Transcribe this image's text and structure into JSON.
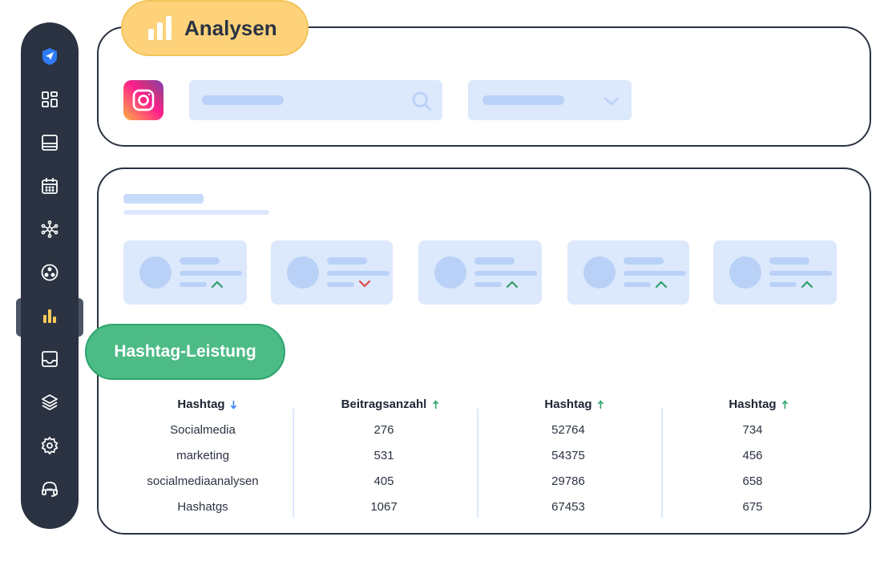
{
  "header": {
    "analysen_label": "Analysen"
  },
  "sidebar": {
    "items": [
      {
        "icon": "send-icon",
        "active": false
      },
      {
        "icon": "dashboard-icon",
        "active": false
      },
      {
        "icon": "posts-icon",
        "active": false
      },
      {
        "icon": "calendar-icon",
        "active": false
      },
      {
        "icon": "network-icon",
        "active": false
      },
      {
        "icon": "community-icon",
        "active": false
      },
      {
        "icon": "analytics-icon",
        "active": true
      },
      {
        "icon": "inbox-icon",
        "active": false
      },
      {
        "icon": "layers-icon",
        "active": false
      },
      {
        "icon": "settings-icon",
        "active": false
      },
      {
        "icon": "support-icon",
        "active": false
      }
    ]
  },
  "filters": {
    "platform_icon": "instagram-icon",
    "search_icon": "search-icon",
    "dropdown_icon": "chevron-down-icon"
  },
  "kpis": [
    {
      "trend": "up"
    },
    {
      "trend": "down"
    },
    {
      "trend": "up"
    },
    {
      "trend": "up"
    },
    {
      "trend": "up"
    }
  ],
  "hashtag_section": {
    "label": "Hashtag-Leistung"
  },
  "table": {
    "columns": [
      {
        "label": "Hashtag",
        "sort": "down"
      },
      {
        "label": "Beitragsanzahl",
        "sort": "up"
      },
      {
        "label": "Hashtag",
        "sort": "up"
      },
      {
        "label": "Hashtag",
        "sort": "up"
      }
    ],
    "rows": [
      [
        "Socialmedia",
        "276",
        "52764",
        "734"
      ],
      [
        "marketing",
        "531",
        "54375",
        "456"
      ],
      [
        "socialmediaanalysen",
        "405",
        "29786",
        "658"
      ],
      [
        "Hashatgs",
        "1067",
        "67453",
        "675"
      ]
    ]
  },
  "colors": {
    "sidebar_bg": "#2b3342",
    "accent_yellow": "#fdd27a",
    "accent_green": "#4cbb86",
    "trend_up": "#2e9e6a",
    "trend_down": "#e0494b",
    "sort_down": "#3b82f6",
    "sort_up": "#2ea56f"
  }
}
